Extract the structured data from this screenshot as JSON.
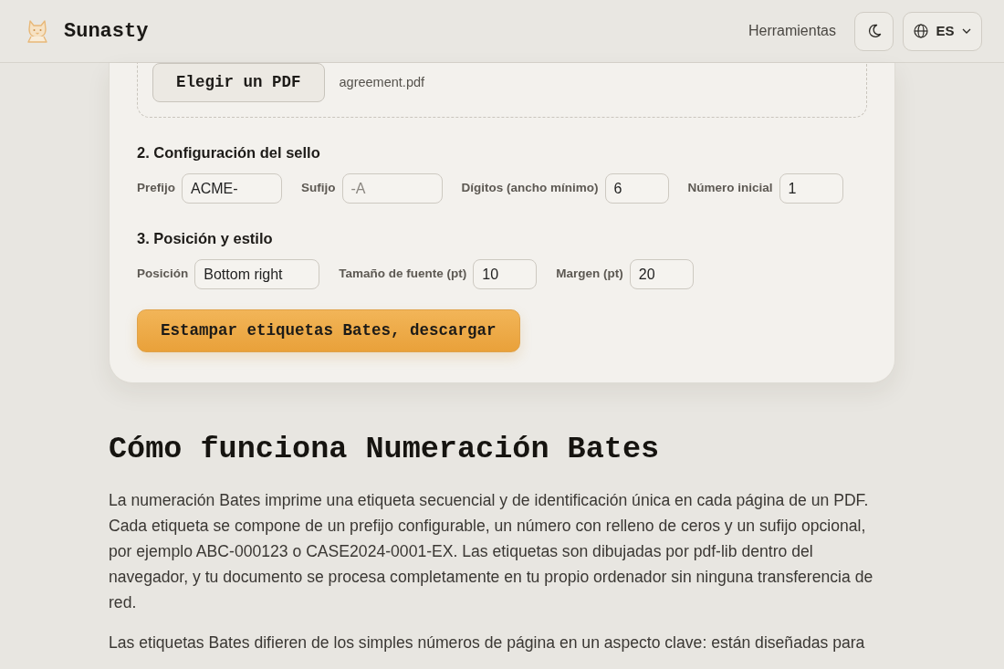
{
  "header": {
    "brand": "Sunasty",
    "nav_link": "Herramientas",
    "language": "ES"
  },
  "uploader": {
    "button": "Elegir un PDF",
    "file_name": "agreement.pdf"
  },
  "sections": [
    {
      "title": "2. Configuración del sello",
      "fields": [
        {
          "kind": "text",
          "label": "Prefijo",
          "value": "ACME-"
        },
        {
          "kind": "text",
          "label": "Sufijo",
          "placeholder": "-A"
        },
        {
          "kind": "number",
          "label": "Dígitos (ancho mínimo)",
          "value": "6"
        },
        {
          "kind": "number",
          "label": "Número inicial",
          "value": "1"
        }
      ]
    },
    {
      "title": "3. Posición y estilo",
      "fields": [
        {
          "kind": "select",
          "label": "Posición",
          "value": "Bottom right"
        },
        {
          "kind": "number",
          "label": "Tamaño de fuente (pt)",
          "value": "10"
        },
        {
          "kind": "number",
          "label": "Margen (pt)",
          "value": "20"
        }
      ]
    }
  ],
  "submit_button": "Estampar etiquetas Bates, descargar",
  "article": {
    "title": "Cómo funciona Numeración Bates",
    "paragraphs": [
      "La numeración Bates imprime una etiqueta secuencial y de identificación única en cada página de un PDF. Cada etiqueta se compone de un prefijo configurable, un número con relleno de ceros y un sufijo opcional, por ejemplo ABC-000123 o CASE2024-0001-EX. Las etiquetas son dibujadas por pdf-lib dentro del navegador, y tu documento se procesa completamente en tu propio ordenador sin ninguna transferencia de red.",
      "Las etiquetas Bates difieren de los simples números de página en un aspecto clave: están diseñadas para"
    ]
  }
}
